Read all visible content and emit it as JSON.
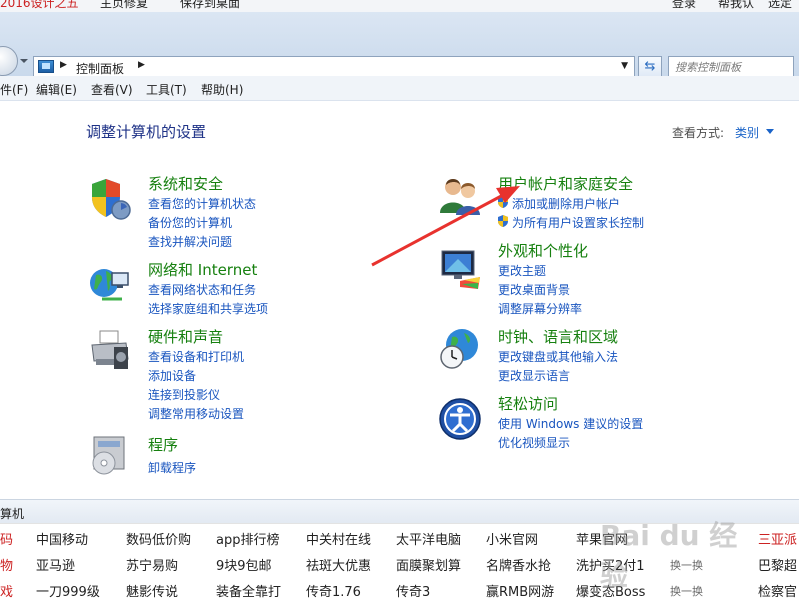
{
  "top_strip": {
    "items": [
      "2016设计之五",
      "主页修复",
      "保存到桌面",
      "登录",
      "帮我认",
      "选定"
    ]
  },
  "address": {
    "breadcrumb": "控制面板",
    "search_placeholder": "搜索控制面板"
  },
  "menu": [
    "件(F)",
    "编辑(E)",
    "查看(V)",
    "工具(T)",
    "帮助(H)"
  ],
  "page": {
    "title": "调整计算机的设置",
    "view_label": "查看方式:",
    "view_value": "类别"
  },
  "categories_left": [
    {
      "icon": "shield-icon",
      "title": "系统和安全",
      "links": [
        "查看您的计算机状态",
        "备份您的计算机",
        "查找并解决问题"
      ]
    },
    {
      "icon": "network-globe-icon",
      "title": "网络和 Internet",
      "links": [
        "查看网络状态和任务",
        "选择家庭组和共享选项"
      ]
    },
    {
      "icon": "printer-icon",
      "title": "硬件和声音",
      "links": [
        "查看设备和打印机",
        "添加设备",
        "连接到投影仪",
        "调整常用移动设置"
      ]
    },
    {
      "icon": "programs-icon",
      "title": "程序",
      "links": [
        "卸载程序"
      ]
    }
  ],
  "categories_right": [
    {
      "icon": "users-icon",
      "title": "用户帐户和家庭安全",
      "links": [
        "添加或删除用户帐户",
        "为所有用户设置家长控制"
      ]
    },
    {
      "icon": "monitor-palette-icon",
      "title": "外观和个性化",
      "links": [
        "更改主题",
        "更改桌面背景",
        "调整屏幕分辨率"
      ]
    },
    {
      "icon": "clock-globe-icon",
      "title": "时钟、语言和区域",
      "links": [
        "更改键盘或其他输入法",
        "更改显示语言"
      ]
    },
    {
      "icon": "accessibility-icon",
      "title": "轻松访问",
      "links": [
        "使用 Windows 建议的设置",
        "优化视频显示"
      ]
    }
  ],
  "status_bar": {
    "text": "算机"
  },
  "link_grid": {
    "rows": [
      [
        "码",
        "中国移动",
        "数码低价购",
        "app排行榜",
        "中关村在线",
        "太平洋电脑",
        "小米官网",
        "苹果官网"
      ],
      [
        "物",
        "亚马逊",
        "苏宁易购",
        "9块9包邮",
        "祛斑大优惠",
        "面膜聚划算",
        "名牌香水抢",
        "洗护买2付1"
      ],
      [
        "戏",
        "一刀999级",
        "魅影传说",
        "装备全靠打",
        "传奇1.76",
        "传奇3",
        "赢RMB网游",
        "爆变态Boss"
      ]
    ],
    "swap_label": "换一换",
    "right_column": [
      "三亚派",
      "巴黎超",
      "检察官"
    ]
  },
  "watermark": {
    "text": "Bai du 经验"
  },
  "colors": {
    "category_title": "#16800f",
    "link": "#1955bf",
    "page_title": "#1e3287",
    "arrow": "#e8322e"
  }
}
